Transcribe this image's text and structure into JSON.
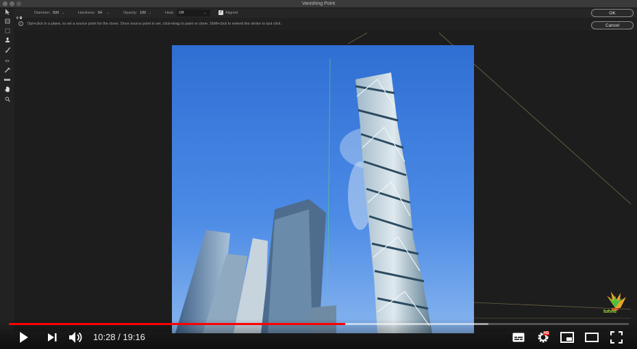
{
  "window": {
    "title": "Vanishing Point"
  },
  "options": {
    "diameter_label": "Diameter:",
    "diameter_value": "500",
    "hardness_label": "Hardness:",
    "hardness_value": "54",
    "opacity_label": "Opacity:",
    "opacity_value": "100",
    "heal_label": "Heal:",
    "heal_value": "Off",
    "aligned_label": "Aligned",
    "aligned_checked": true
  },
  "info": {
    "text": "Opt+click in a plane, to set a source point for the clone. Once source point is set, click+drag to paint or clone. Shift+click to extend the stroke to last click."
  },
  "buttons": {
    "ok": "OK",
    "cancel": "Cancel"
  },
  "tools": [
    "edit-plane-tool-icon",
    "create-plane-tool-icon",
    "marquee-tool-icon",
    "stamp-tool-icon",
    "brush-tool-icon",
    "transform-tool-icon",
    "eyedropper-tool-icon",
    "measure-tool-icon",
    "hand-tool-icon",
    "zoom-tool-icon"
  ],
  "player": {
    "current_time": "10:28",
    "duration": "19:16",
    "time_display": "10:28 / 19:16",
    "progress_fraction": 0.543,
    "hd_badge": "HD",
    "logo_text": "tutvid",
    "accent_color": "#ff0000"
  }
}
